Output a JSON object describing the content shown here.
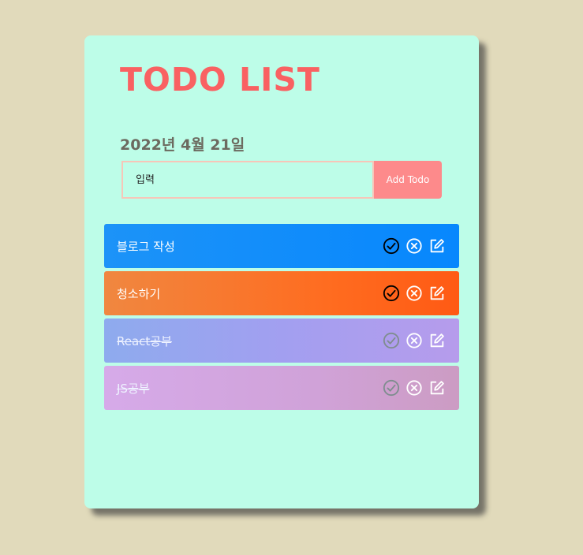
{
  "header": {
    "title": "TODO LIST",
    "date": "2022년 4월 21일"
  },
  "form": {
    "input_value": "",
    "input_placeholder": "입력",
    "add_label": "Add Todo"
  },
  "todos": [
    {
      "text": "블로그 작성",
      "done": false
    },
    {
      "text": "청소하기",
      "done": false
    },
    {
      "text": "React공부",
      "done": true
    },
    {
      "text": "JS공부",
      "done": true
    }
  ],
  "icons": {
    "check": "check-circle-icon",
    "delete": "x-circle-icon",
    "edit": "edit-icon"
  },
  "colors": {
    "page_background": "#e1dabb",
    "card_background": "#bdfde8",
    "title": "#f96162",
    "date": "#6c6a5f",
    "input_border": "#f7c6b8",
    "add_button": "#fd8a8b",
    "todo_1": "#1c93f8",
    "todo_2": "#ff6b1f",
    "todo_3": "#a29ff0",
    "todo_4": "#d3a7e1",
    "check_active": "#000000",
    "check_done": "#7f8d8f"
  }
}
